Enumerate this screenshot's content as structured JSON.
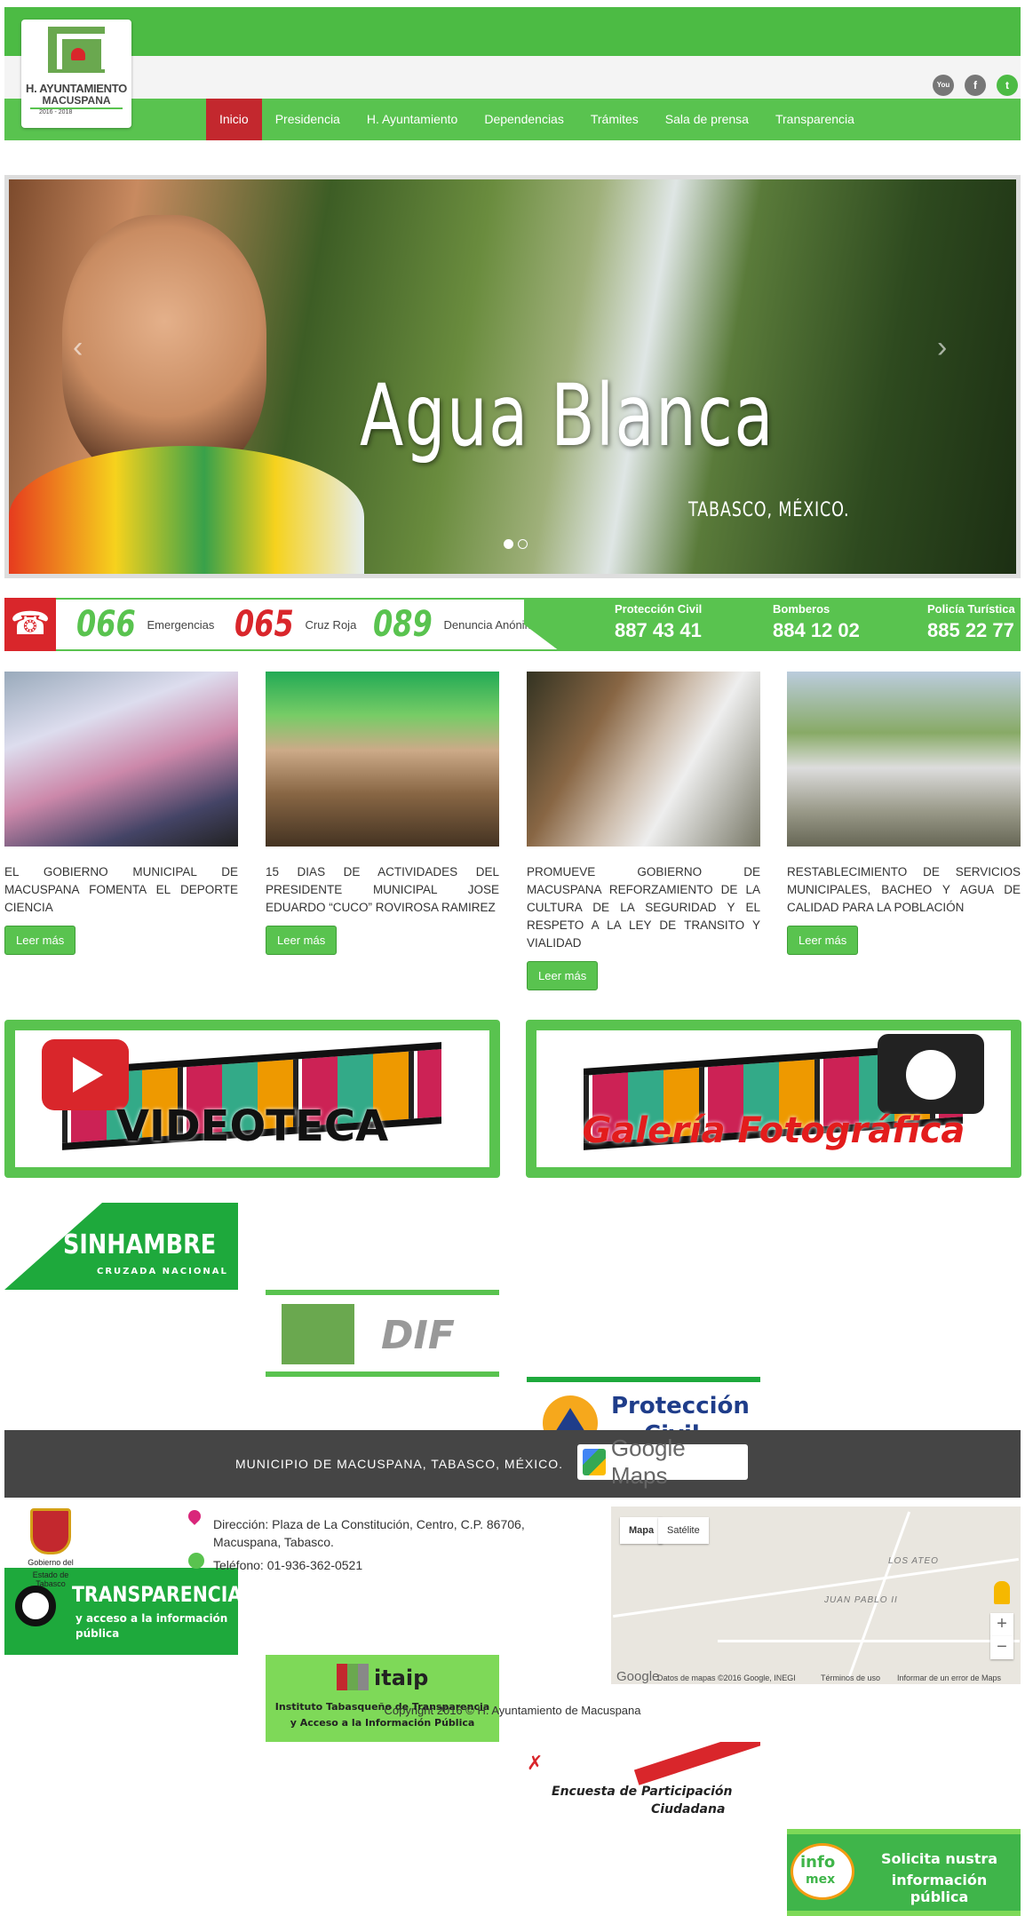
{
  "header": {
    "logo": {
      "line1": "H. AYUNTAMIENTO",
      "line2": "MACUSPANA",
      "line3": "2016 - 2018"
    },
    "nav": [
      "Inicio",
      "Presidencia",
      "H. Ayuntamiento",
      "Dependencias",
      "Trámites",
      "Sala de prensa",
      "Transparencia"
    ],
    "social": [
      {
        "icon": "youtube-icon",
        "glyph": "You"
      },
      {
        "icon": "facebook-icon",
        "glyph": "f"
      },
      {
        "icon": "twitter-icon",
        "glyph": "t"
      }
    ]
  },
  "slider": {
    "title": "Agua Blanca",
    "subtitle": "TABASCO, MÉXICO.",
    "prev": "‹",
    "next": "›",
    "slides_total": 2,
    "active_slide": 1
  },
  "emergency": {
    "phone_icon": "☎",
    "numbers": [
      {
        "num": "066",
        "label": "Emergencias",
        "color": "#59c34f"
      },
      {
        "num": "065",
        "label": "Cruz Roja",
        "color": "#d9262b"
      },
      {
        "num": "089",
        "label": "Denuncia Anónima",
        "color": "#59c34f"
      }
    ],
    "services": [
      {
        "name": "Protección Civil",
        "phone": "887 43 41"
      },
      {
        "name": "Bomberos",
        "phone": "884 12 02"
      },
      {
        "name": "Policía Turística",
        "phone": "885 22 77"
      }
    ]
  },
  "news": [
    {
      "text": "EL GOBIERNO MUNICIPAL DE MACUSPANA FOMENTA EL DEPORTE CIENCIA",
      "button": "Leer más"
    },
    {
      "text": "15 DIAS DE ACTIVIDADES DEL PRESIDENTE MUNICIPAL JOSE EDUARDO “CUCO” ROVIROSA RAMIREZ",
      "button": "Leer más"
    },
    {
      "text": "PROMUEVE GOBIERNO DE MACUSPANA REFORZAMIENTO DE LA CULTURA DE LA SEGURIDAD Y EL RESPETO A LA LEY DE TRANSITO Y VIALIDAD",
      "button": "Leer más"
    },
    {
      "text": "RESTABLECIMIENTO DE SERVICIOS MUNICIPALES, BACHEO Y AGUA DE CALIDAD PARA LA POBLACIÓN",
      "button": "Leer más"
    }
  ],
  "banners": [
    "VIDEOTECA",
    "Galería Fotográfica"
  ],
  "tiles": {
    "sinhambre": {
      "big": "SINHAMBRE",
      "small": "CRUZADA NACIONAL"
    },
    "dif": "DIF",
    "proteccion": {
      "l1": "Protección",
      "l2": "Civil"
    },
    "transparencia": {
      "big": "TRANSPARENCIA",
      "l1": "y acceso a la información",
      "l2": "pública"
    },
    "itaip": {
      "logo": "itaip",
      "l1": "Instituto Tabasqueño de Transparencia",
      "l2": "y Acceso a la Información Pública"
    },
    "encuesta": {
      "l1": "Encuesta de Participación",
      "l2": "Ciudadana"
    },
    "infomex": {
      "logo1": "info",
      "logo2": "mex",
      "l1": "Solicita nustra",
      "l2": "información pública"
    }
  },
  "footer": {
    "bar_text": "MUNICIPIO DE MACUSPANA, TABASCO, MÉXICO.",
    "gmaps_label": "Google Maps",
    "crest_text1": "Gobierno del",
    "crest_text2": "Estado de Tabasco",
    "address1": "Dirección: Plaza de La Constitución, Centro, C.P. 86706,",
    "address2": "Macuspana, Tabasco.",
    "phone": "Teléfono: 01-936-362-0521",
    "map": {
      "tab_map": "Mapa",
      "tab_sat": "Satélite",
      "label1": "LOS ATEO",
      "label2": "JUAN PABLO II",
      "zoom_in": "+",
      "zoom_out": "−",
      "brand": "Google",
      "attr1": "Datos de mapas ©2016 Google, INEGI",
      "attr2": "Términos de uso",
      "attr3": "Informar de un error de Maps"
    },
    "copyright": "Copyright 2016 © H. Ayuntamiento de Macuspana"
  },
  "colors": {
    "brand_green": "#59c34f",
    "accent_red": "#c3282e",
    "footer_dark": "#454545"
  }
}
